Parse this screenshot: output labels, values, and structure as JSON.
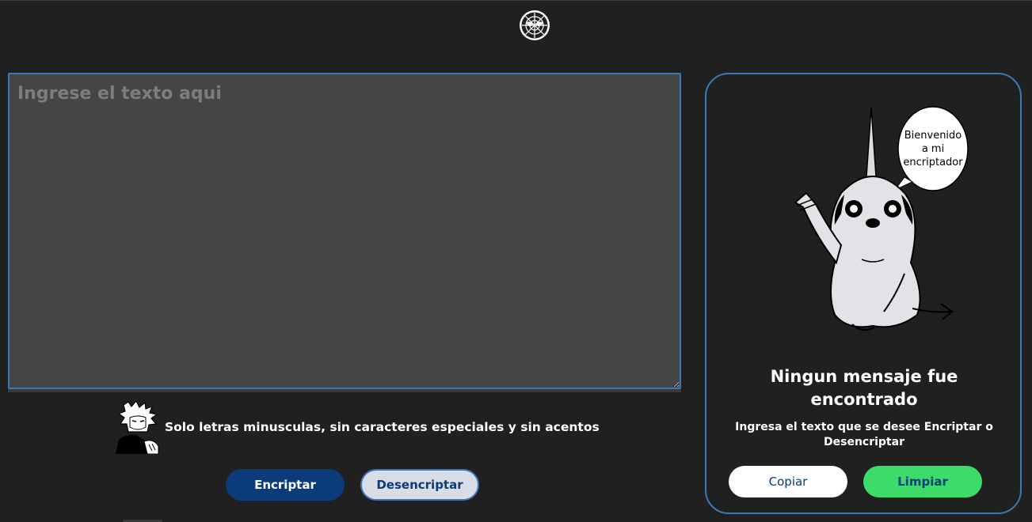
{
  "header": {
    "logo_icon": "spider-mask-icon"
  },
  "input": {
    "placeholder": "Ingrese el texto aqui",
    "value": ""
  },
  "hint": {
    "icon": "anime-character-icon",
    "text": "Solo letras minusculas, sin caracteres especiales y sin acentos"
  },
  "actions": {
    "encrypt_label": "Encriptar",
    "decrypt_label": "Desencriptar"
  },
  "output": {
    "bubble_line1": "Bienvenido",
    "bubble_line2": "a mi",
    "bubble_line3": "encriptador",
    "title": "Ningun mensaje fue encontrado",
    "subtitle": "Ingresa el texto que se desee Encriptar o Desencriptar",
    "copy_label": "Copiar",
    "clear_label": "Limpiar"
  },
  "colors": {
    "background": "#202020",
    "accent_blue": "#0b3b78",
    "border_blue": "#3b78b8",
    "clear_green": "#3ddc6a"
  }
}
